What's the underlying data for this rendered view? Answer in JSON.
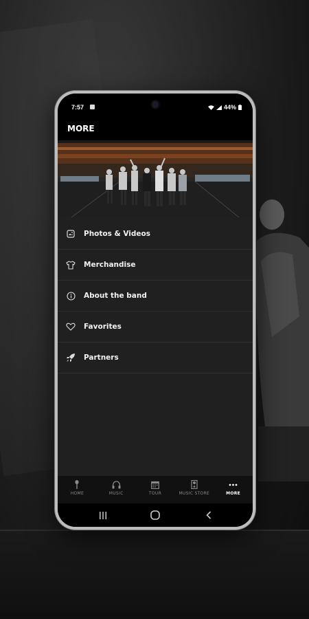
{
  "status_bar": {
    "time": "7:57",
    "battery": "44%"
  },
  "header": {
    "title": "MORE"
  },
  "menu": {
    "items": [
      {
        "label": "Photos & Videos",
        "icon": "photo-album-icon"
      },
      {
        "label": "Merchandise",
        "icon": "tshirt-icon"
      },
      {
        "label": "About the band",
        "icon": "info-icon"
      },
      {
        "label": "Favorites",
        "icon": "heart-icon"
      },
      {
        "label": "Partners",
        "icon": "rocket-icon"
      }
    ]
  },
  "tabbar": {
    "tabs": [
      {
        "label": "HOME",
        "icon": "microphone-icon",
        "active": false
      },
      {
        "label": "MUSIC",
        "icon": "headphones-icon",
        "active": false
      },
      {
        "label": "TOUR",
        "icon": "calendar-icon",
        "active": false
      },
      {
        "label": "MUSIC STORE",
        "icon": "guitar-amp-icon",
        "active": false
      },
      {
        "label": "MORE",
        "icon": "more-dots-icon",
        "active": true
      }
    ]
  },
  "colors": {
    "screen_bg": "#202020",
    "bar_bg": "#000000",
    "text": "#f2f2f2",
    "inactive_tab": "#8a8a8a"
  }
}
